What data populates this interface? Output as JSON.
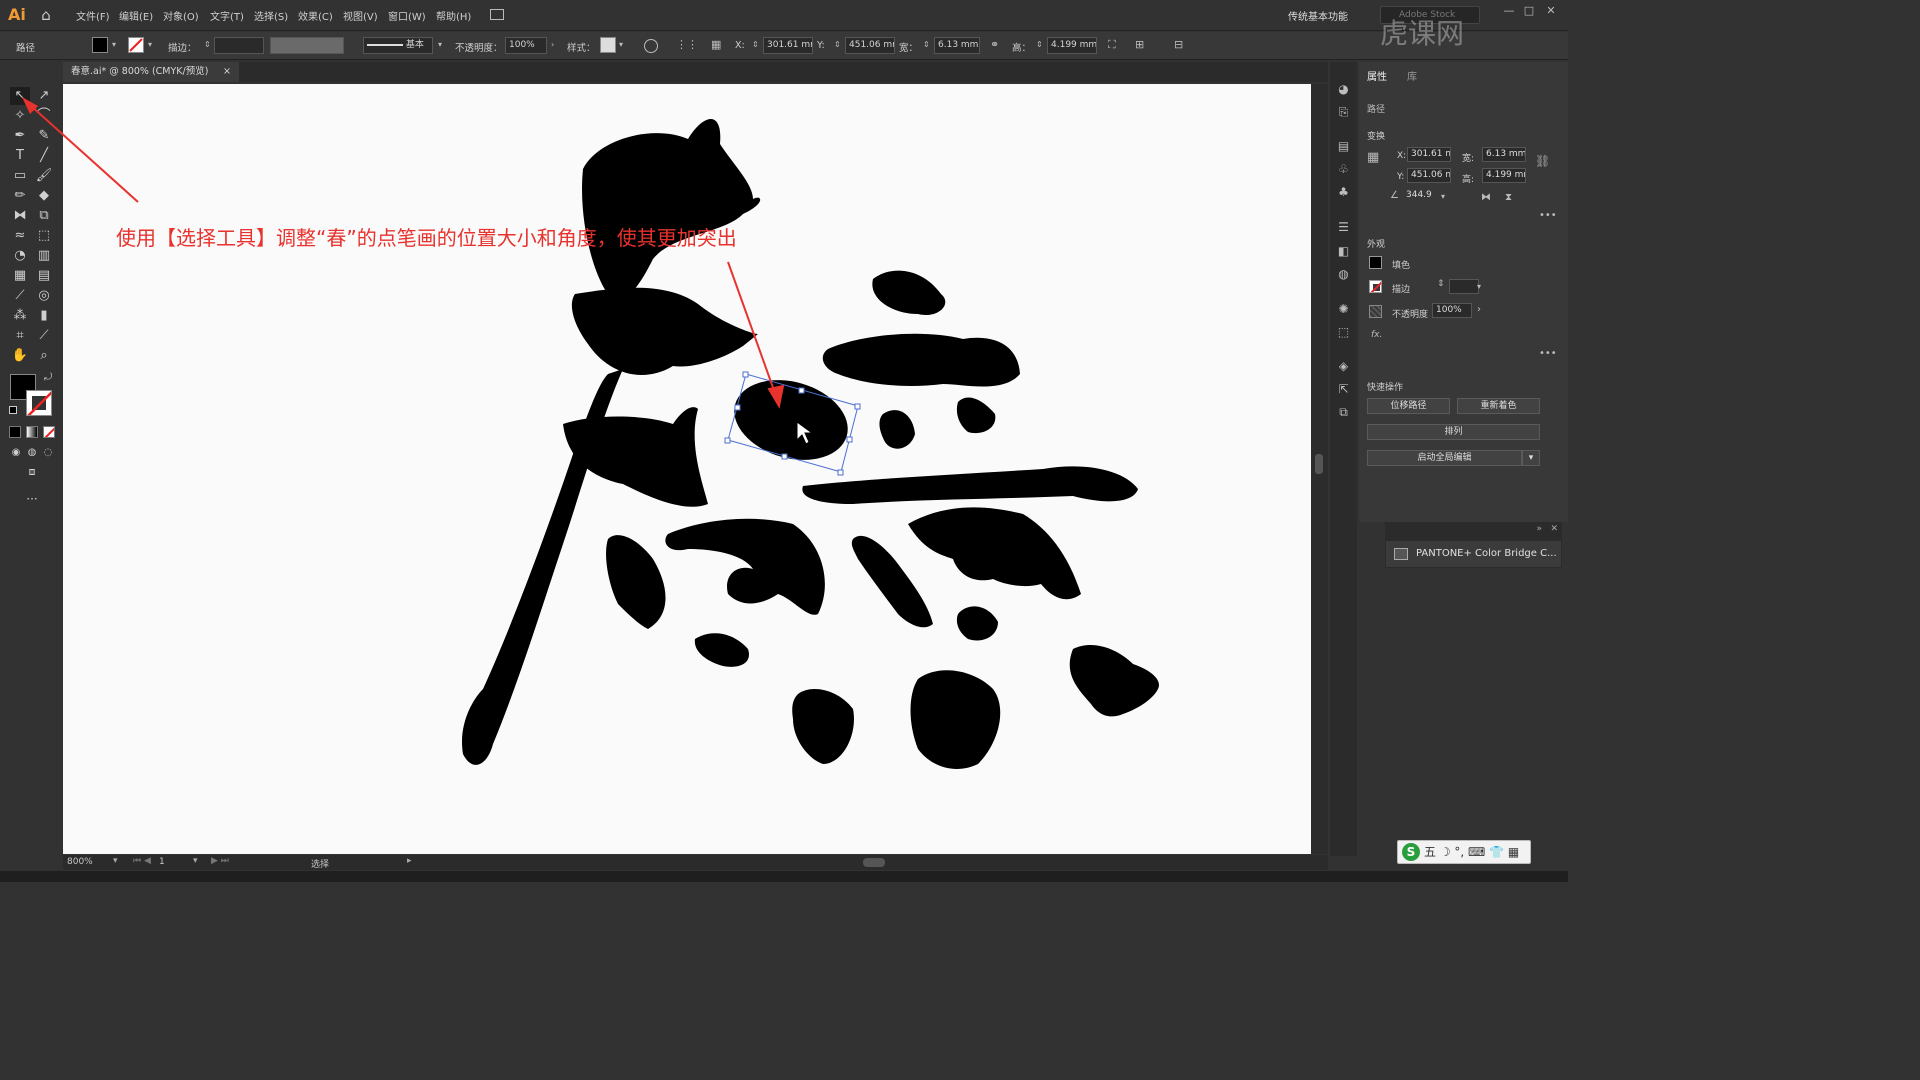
{
  "app": {
    "logo": "Ai"
  },
  "menu": [
    "文件(F)",
    "编辑(E)",
    "对象(O)",
    "文字(T)",
    "选择(S)",
    "效果(C)",
    "视图(V)",
    "窗口(W)",
    "帮助(H)"
  ],
  "workspace": "传统基本功能",
  "search_placeholder": "Adobe Stock",
  "window_controls": [
    "—",
    "□",
    "✕"
  ],
  "control_bar": {
    "object_type": "路径",
    "stroke_label": "描边：",
    "brush_label": "基本",
    "opacity_label": "不透明度：",
    "opacity_value": "100%",
    "style_label": "样式：",
    "x_label": "X:",
    "x_value": "301.61 mm",
    "y_label": "Y:",
    "y_value": "451.06 mm",
    "w_label": "宽：",
    "w_value": "6.13 mm",
    "h_label": "高：",
    "h_value": "4.199 mm"
  },
  "document_tab": {
    "title": "春意.ai* @ 800% (CMYK/预览)",
    "close": "×"
  },
  "annotation": "使用【选择工具】调整“春”的点笔画的位置大小和角度，使其更加突出",
  "status_bar": {
    "zoom": "800%",
    "artboard": "1",
    "mode": "选择"
  },
  "properties_panel": {
    "tabs": [
      "属性",
      "库"
    ],
    "object_type": "路径",
    "transform_title": "变换",
    "x_label": "X:",
    "x_value": "301.61 m",
    "y_label": "Y:",
    "y_value": "451.06 m",
    "w_label": "宽:",
    "w_value": "6.13 mm",
    "h_label": "高:",
    "h_value": "4.199 mm",
    "angle_value": "344.9",
    "appearance_title": "外观",
    "fill_label": "填色",
    "stroke_label": "描边",
    "opacity_label": "不透明度",
    "opacity_value": "100%",
    "fx_label": "fx.",
    "quick_actions_title": "快速操作",
    "btn_offset_path": "位移路径",
    "btn_recolor": "重新着色",
    "btn_arrange": "排列",
    "btn_global_edit": "启动全局编辑"
  },
  "floating_panel": {
    "label": "PANTONE+ Color Bridge C..."
  },
  "ime_bar": {
    "label": "五 ☽ °, ⌨ 👕 ▦"
  },
  "watermark": "虎课网",
  "colors": {
    "annotation_red": "#e8322e",
    "canvas": "#fafafa",
    "ui_dark": "#323232"
  }
}
